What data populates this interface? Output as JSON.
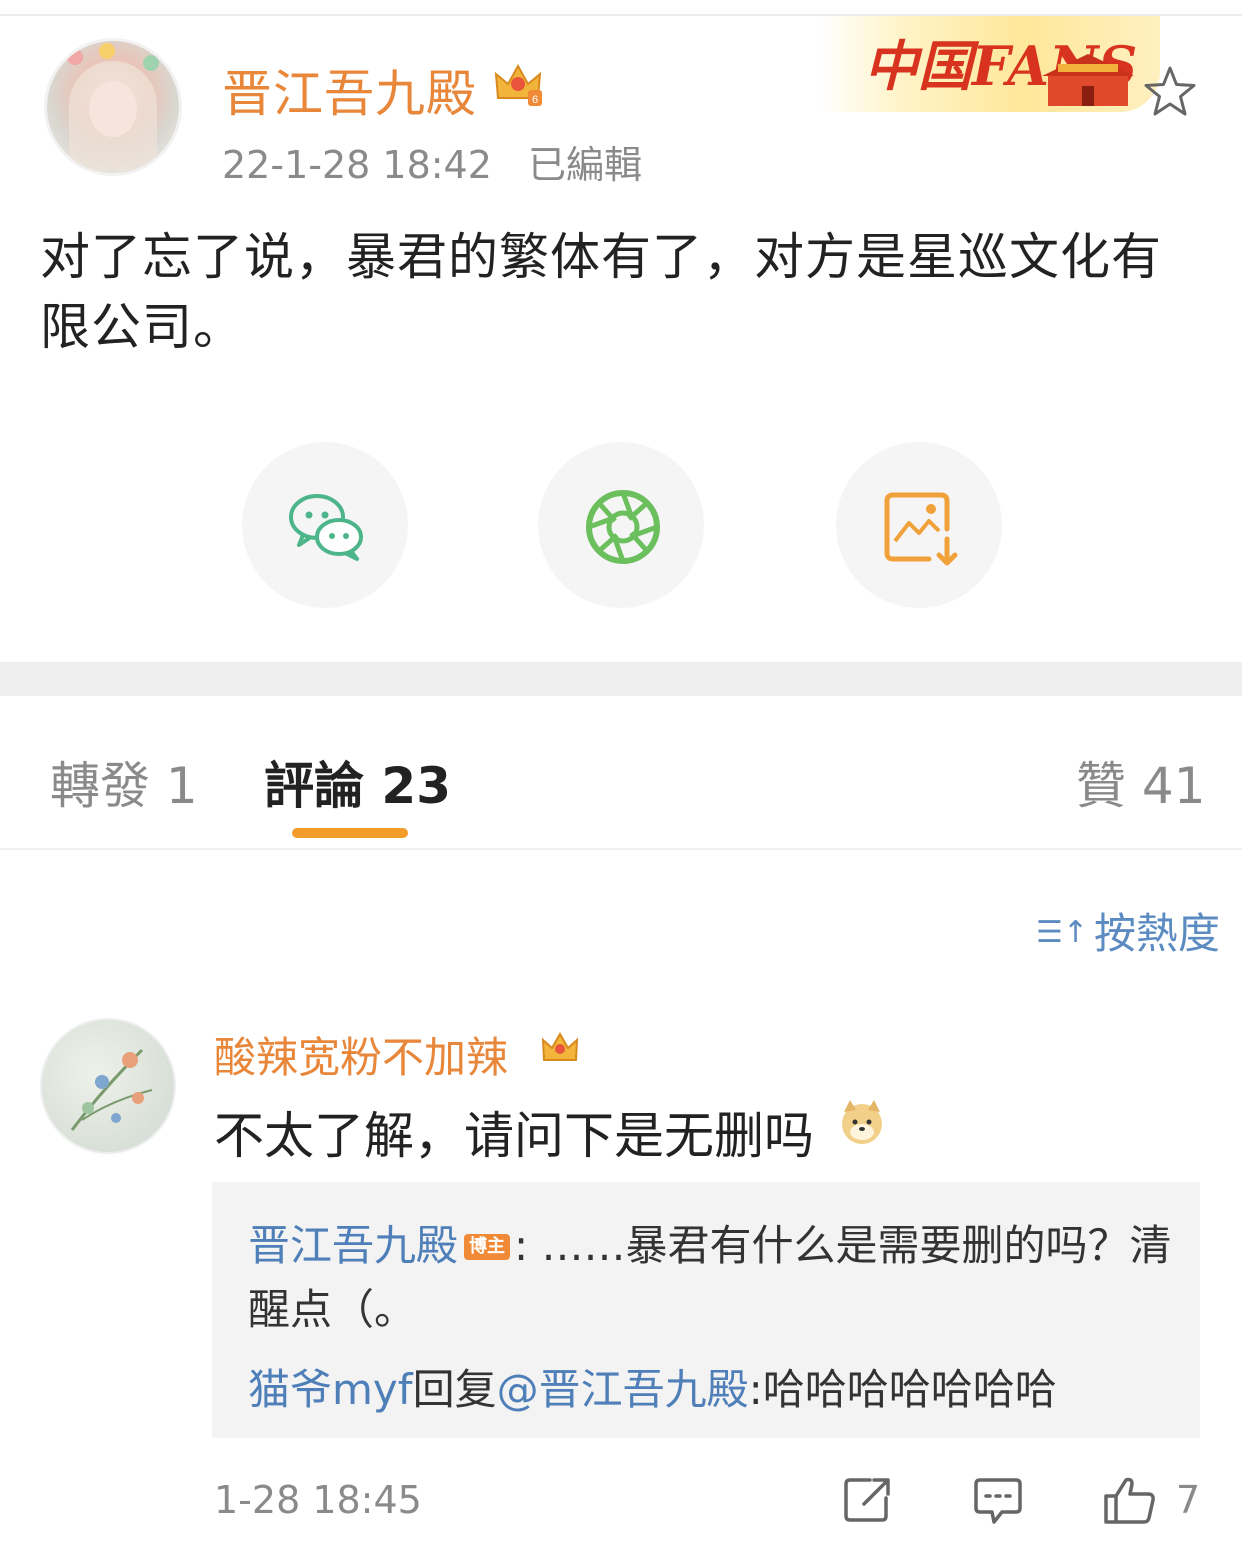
{
  "post": {
    "author": "晋江吾九殿",
    "timestamp": "22-1-28 18:42",
    "edited_label": "已編輯",
    "banner_text": "中国FANS",
    "text": "对了忘了说，暴君的繁体有了，对方是星巡文化有限公司。"
  },
  "share_buttons": [
    {
      "name": "wechat-icon",
      "color": "#4cb58a"
    },
    {
      "name": "moments-icon",
      "color": "#6bbf5d"
    },
    {
      "name": "save-image-icon",
      "color": "#f0a13a"
    }
  ],
  "tabs": {
    "repost": "轉發 1",
    "comments": "評論 23",
    "likes": "贊 41"
  },
  "sort": {
    "label": "按熱度"
  },
  "comment": {
    "author": "酸辣宽粉不加辣",
    "text": "不太了解，请问下是无删吗",
    "reply_author": "晋江吾九殿",
    "reply_badge": "博主",
    "reply_text": ":  ……暴君有什么是需要删的吗？清醒点（。",
    "reply2_author": "猫爷myf",
    "reply2_verb": "回复",
    "reply2_mention": "@晋江吾九殿",
    "reply2_text": ":哈哈哈哈哈哈哈",
    "time": "1-28 18:45",
    "like_count": "7"
  },
  "colors": {
    "accent_orange": "#e8863a",
    "link_blue": "#4f7fb8",
    "tab_underline": "#f39c2a"
  }
}
